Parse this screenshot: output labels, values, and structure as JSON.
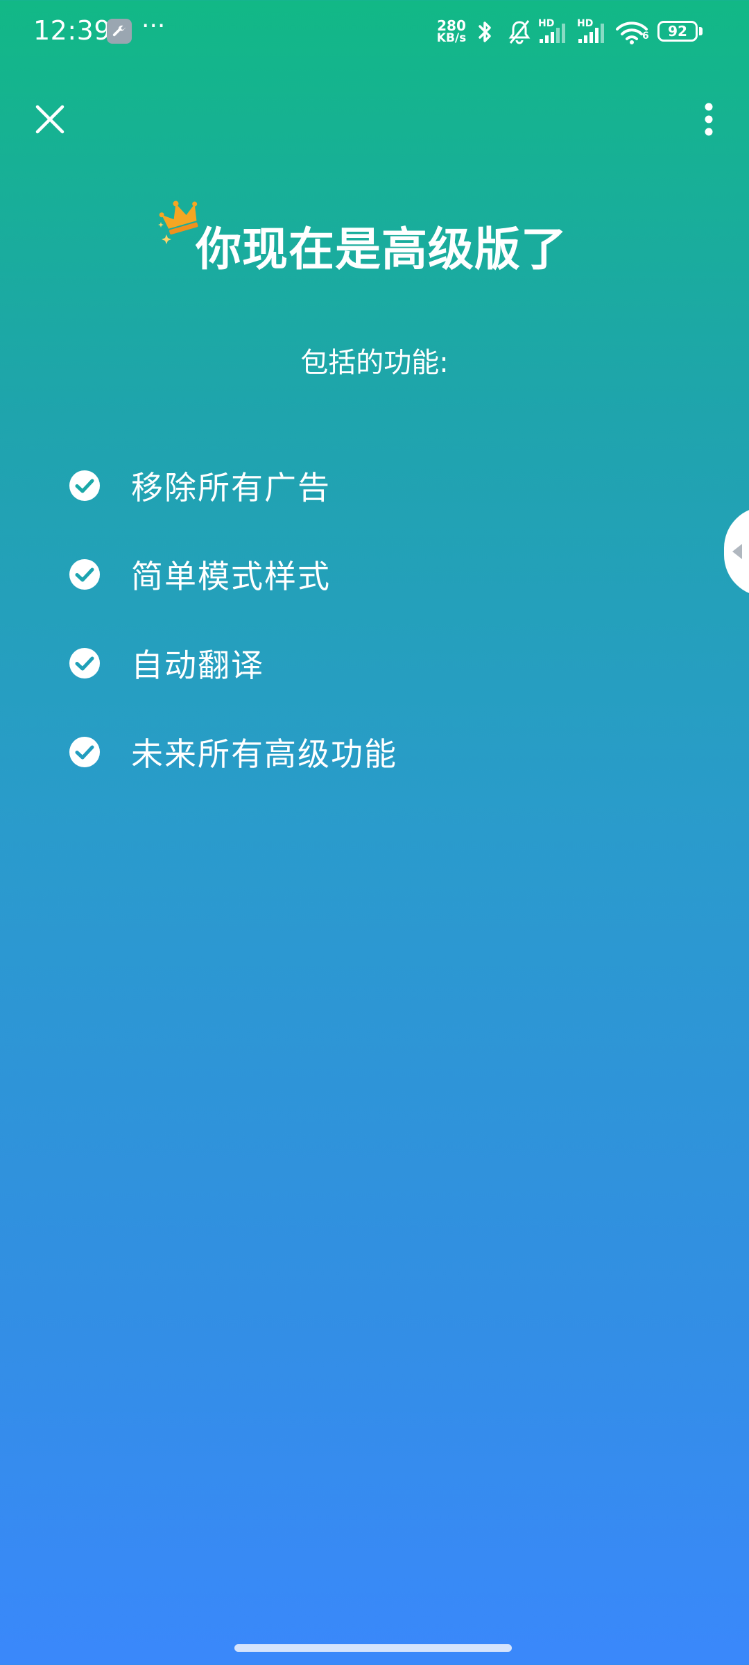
{
  "status_bar": {
    "time": "12:39",
    "net_speed_value": "280",
    "net_speed_unit": "KB/s",
    "sim1_label": "HD",
    "sim2_label": "HD",
    "wifi_label": "6",
    "battery_level": "92",
    "icons": [
      "wrench-icon",
      "more-dots-icon",
      "bluetooth-icon",
      "bell-muted-icon",
      "signal-icon",
      "signal-icon",
      "wifi-icon",
      "battery-icon"
    ]
  },
  "app_bar": {
    "close_icon": "close-icon",
    "menu_icon": "more-vertical-icon"
  },
  "header": {
    "title": "你现在是高级版了",
    "crown_icon": "crown-icon",
    "subtitle": "包括的功能:"
  },
  "features": [
    {
      "label": "移除所有广告",
      "icon": "check-circle-icon"
    },
    {
      "label": "简单模式样式",
      "icon": "check-circle-icon"
    },
    {
      "label": "自动翻译",
      "icon": "check-circle-icon"
    },
    {
      "label": "未来所有高级功能",
      "icon": "check-circle-icon"
    }
  ],
  "colors": {
    "gradient_top": "#12b886",
    "gradient_bottom": "#3a88fb",
    "check_fill": "#ffffff",
    "check_mark": "#1aa8a8",
    "crown": "#f5a623"
  }
}
